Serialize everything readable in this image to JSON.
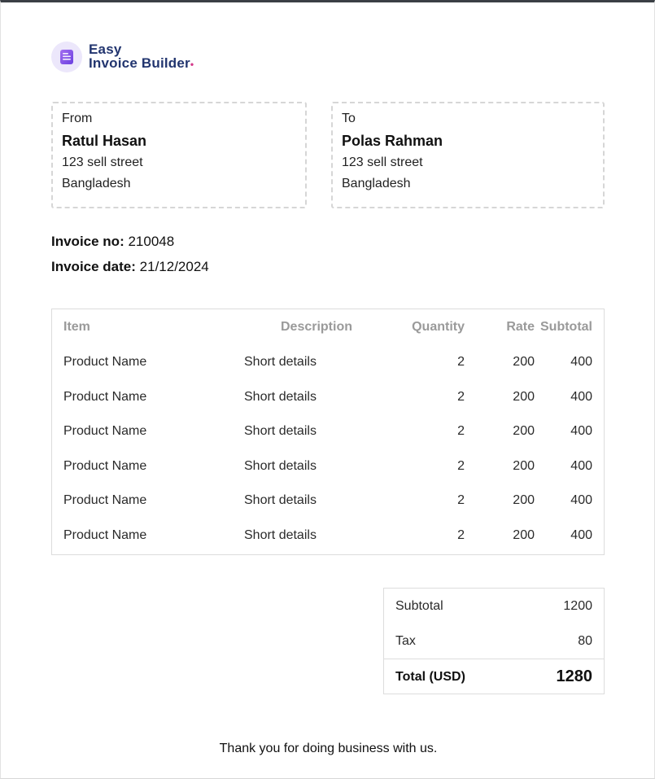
{
  "brand": {
    "line1": "Easy",
    "line2": "Invoice Builder",
    "dot": "•",
    "colors": {
      "text": "#22356f",
      "accent": "#d43a8a",
      "mark_bg": "#ece7fb",
      "mark_fg": "#8a52e8"
    },
    "icon": "document-icon"
  },
  "from": {
    "label": "From",
    "name": "Ratul Hasan",
    "street": "123 sell street",
    "country": "Bangladesh"
  },
  "to": {
    "label": "To",
    "name": "Polas Rahman",
    "street": "123 sell street",
    "country": "Bangladesh"
  },
  "invoice": {
    "number_label": "Invoice no:",
    "number": "210048",
    "date_label": "Invoice date:",
    "date": "21/12/2024"
  },
  "items_table": {
    "headers": [
      "Item",
      "Description",
      "Quantity",
      "Rate",
      "Subtotal"
    ],
    "rows": [
      {
        "item": "Product Name",
        "description": "Short details",
        "quantity": "2",
        "rate": "200",
        "subtotal": "400"
      },
      {
        "item": "Product Name",
        "description": "Short details",
        "quantity": "2",
        "rate": "200",
        "subtotal": "400"
      },
      {
        "item": "Product Name",
        "description": "Short details",
        "quantity": "2",
        "rate": "200",
        "subtotal": "400"
      },
      {
        "item": "Product Name",
        "description": "Short details",
        "quantity": "2",
        "rate": "200",
        "subtotal": "400"
      },
      {
        "item": "Product Name",
        "description": "Short details",
        "quantity": "2",
        "rate": "200",
        "subtotal": "400"
      },
      {
        "item": "Product Name",
        "description": "Short details",
        "quantity": "2",
        "rate": "200",
        "subtotal": "400"
      }
    ]
  },
  "totals": {
    "subtotal_label": "Subtotal",
    "subtotal": "1200",
    "tax_label": "Tax",
    "tax": "80",
    "total_label": "Total (USD)",
    "total": "1280"
  },
  "footer": {
    "thanks": "Thank you for doing business with us."
  }
}
